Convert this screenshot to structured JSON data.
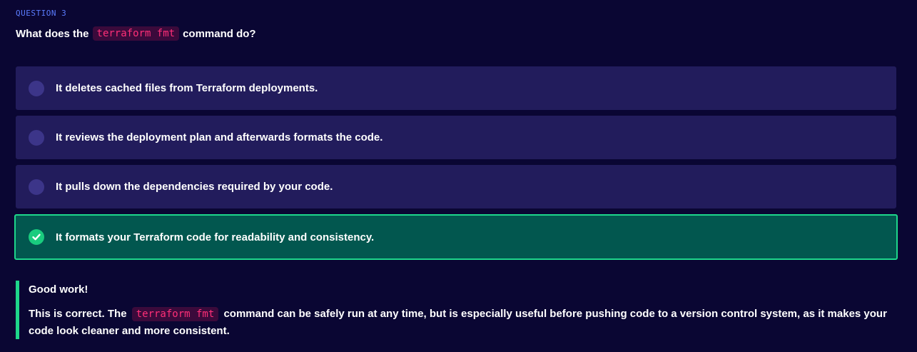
{
  "question": {
    "label": "QUESTION 3",
    "prefix": "What does the",
    "code": "terraform fmt",
    "suffix": "command do?"
  },
  "options": [
    {
      "label": "It deletes cached files from Terraform deployments.",
      "state": "unselected"
    },
    {
      "label": "It reviews the deployment plan and afterwards formats the code.",
      "state": "unselected"
    },
    {
      "label": "It pulls down the dependencies required by your code.",
      "state": "unselected"
    },
    {
      "label": "It formats your Terraform code for readability and consistency.",
      "state": "correct"
    }
  ],
  "feedback": {
    "title": "Good work!",
    "body_prefix": "This is correct. The",
    "code": "terraform fmt",
    "body_suffix": "command can be safely run at any time, but is especially useful before pushing code to a version control system, as it makes your code look cleaner and more consistent."
  },
  "colors": {
    "background": "#0a0633",
    "option_bg": "#221c5c",
    "correct_bg": "#02574f",
    "correct_border": "#1ed68b",
    "code_text": "#ff2f78",
    "label_blue": "#5b7cff"
  },
  "icons": {
    "correct": "checkmark-circle-icon",
    "unselected": "radio-circle-icon"
  }
}
